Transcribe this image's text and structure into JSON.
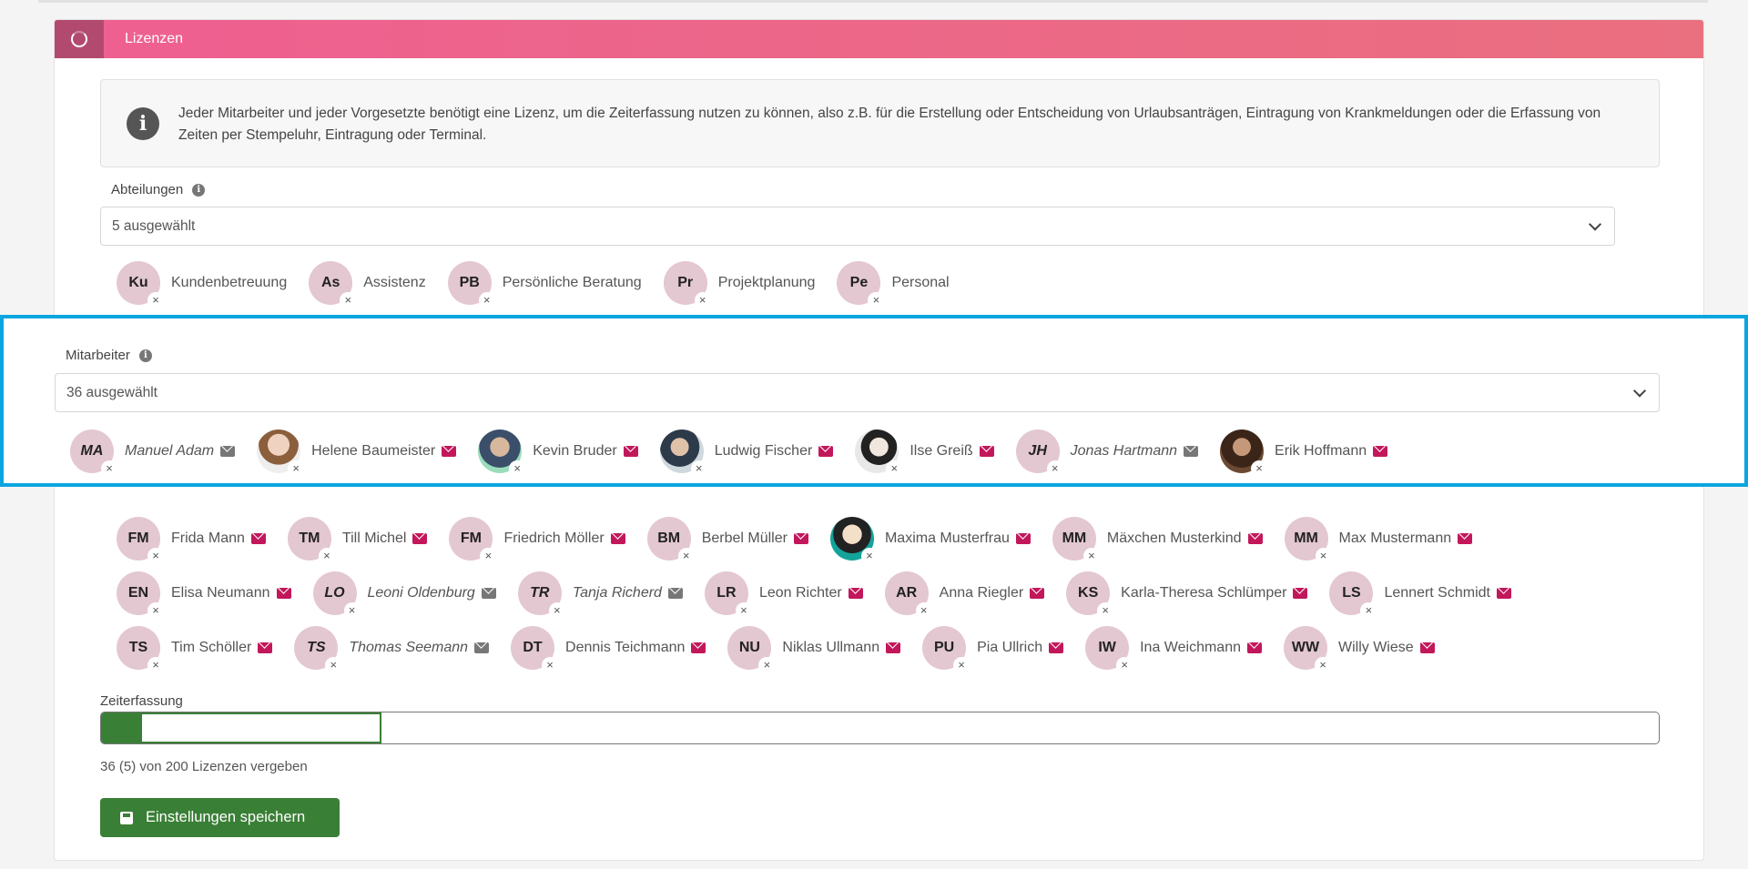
{
  "header": {
    "title": "Lizenzen"
  },
  "info": {
    "text": "Jeder Mitarbeiter und jeder Vorgesetzte benötigt eine Lizenz, um die Zeiterfassung nutzen zu können, also z.B. für die Erstellung oder Entscheidung von Urlaubsanträgen, Eintragung von Krankmeldungen oder die Erfassung von Zeiten per Stempeluhr, Eintragung oder Terminal."
  },
  "departments": {
    "label": "Abteilungen",
    "selected_text": "5 ausgewählt",
    "items": [
      {
        "initials": "Ku",
        "name": "Kundenbetreuung"
      },
      {
        "initials": "As",
        "name": "Assistenz"
      },
      {
        "initials": "PB",
        "name": "Persönliche Beratung"
      },
      {
        "initials": "Pr",
        "name": "Projektplanung"
      },
      {
        "initials": "Pe",
        "name": "Personal"
      }
    ]
  },
  "employees": {
    "label": "Mitarbeiter",
    "selected_text": "36 ausgewählt",
    "highlighted_row": [
      {
        "initials": "MA",
        "name": "Manuel Adam",
        "italic": true,
        "mail_color": "#777777"
      },
      {
        "initials": "",
        "name": "Helene Baumeister",
        "photo": "photo1",
        "mail_color": "#c2185b"
      },
      {
        "initials": "",
        "name": "Kevin Bruder",
        "photo": "photo2",
        "mail_color": "#c2185b"
      },
      {
        "initials": "",
        "name": "Ludwig Fischer",
        "photo": "photo3",
        "mail_color": "#c2185b"
      },
      {
        "initials": "",
        "name": "Ilse Greiß",
        "photo": "photo4",
        "mail_color": "#c2185b"
      },
      {
        "initials": "JH",
        "name": "Jonas Hartmann",
        "italic": true,
        "mail_color": "#777777"
      },
      {
        "initials": "",
        "name": "Erik Hoffmann",
        "photo": "photo5",
        "mail_color": "#c2185b"
      }
    ],
    "row_fm": [
      {
        "initials": "FM",
        "name": "Frida Mann"
      },
      {
        "initials": "TM",
        "name": "Till Michel"
      },
      {
        "initials": "FM",
        "name": "Friedrich Möller"
      },
      {
        "initials": "BM",
        "name": "Berbel Müller"
      },
      {
        "initials": "",
        "name": "Maxima Musterfrau",
        "photo": "photo6"
      },
      {
        "initials": "MM",
        "name": "Mäxchen Musterkind"
      },
      {
        "initials": "MM",
        "name": "Max Mustermann"
      }
    ],
    "row_en": [
      {
        "initials": "EN",
        "name": "Elisa Neumann"
      },
      {
        "initials": "LO",
        "name": "Leoni Oldenburg",
        "italic": true,
        "mail_color": "#777777"
      },
      {
        "initials": "TR",
        "name": "Tanja Richerd",
        "italic": true,
        "mail_color": "#777777"
      },
      {
        "initials": "LR",
        "name": "Leon Richter"
      },
      {
        "initials": "AR",
        "name": "Anna Riegler"
      },
      {
        "initials": "KS",
        "name": "Karla-Theresa Schlümper"
      },
      {
        "initials": "LS",
        "name": "Lennert Schmidt"
      }
    ],
    "row_ts": [
      {
        "initials": "TS",
        "name": "Tim Schöller"
      },
      {
        "initials": "TS",
        "name": "Thomas Seemann",
        "italic": true,
        "mail_color": "#777777"
      },
      {
        "initials": "DT",
        "name": "Dennis Teichmann"
      },
      {
        "initials": "NU",
        "name": "Niklas Ullmann"
      },
      {
        "initials": "PU",
        "name": "Pia Ullrich"
      },
      {
        "initials": "IW",
        "name": "Ina Weichmann"
      },
      {
        "initials": "WW",
        "name": "Willy Wiese"
      }
    ]
  },
  "time_tracking": {
    "label": "Zeiterfassung",
    "assigned": 36,
    "assigned_extra": 5,
    "total": 200,
    "status_text": "36 (5) von 200 Lizenzen vergeben"
  },
  "save_button": {
    "label": "Einstellungen speichern"
  },
  "colors": {
    "accent": "#ee5f91",
    "highlight_border": "#0aa6e0",
    "success": "#3a7f36",
    "mail": "#c2185b"
  }
}
